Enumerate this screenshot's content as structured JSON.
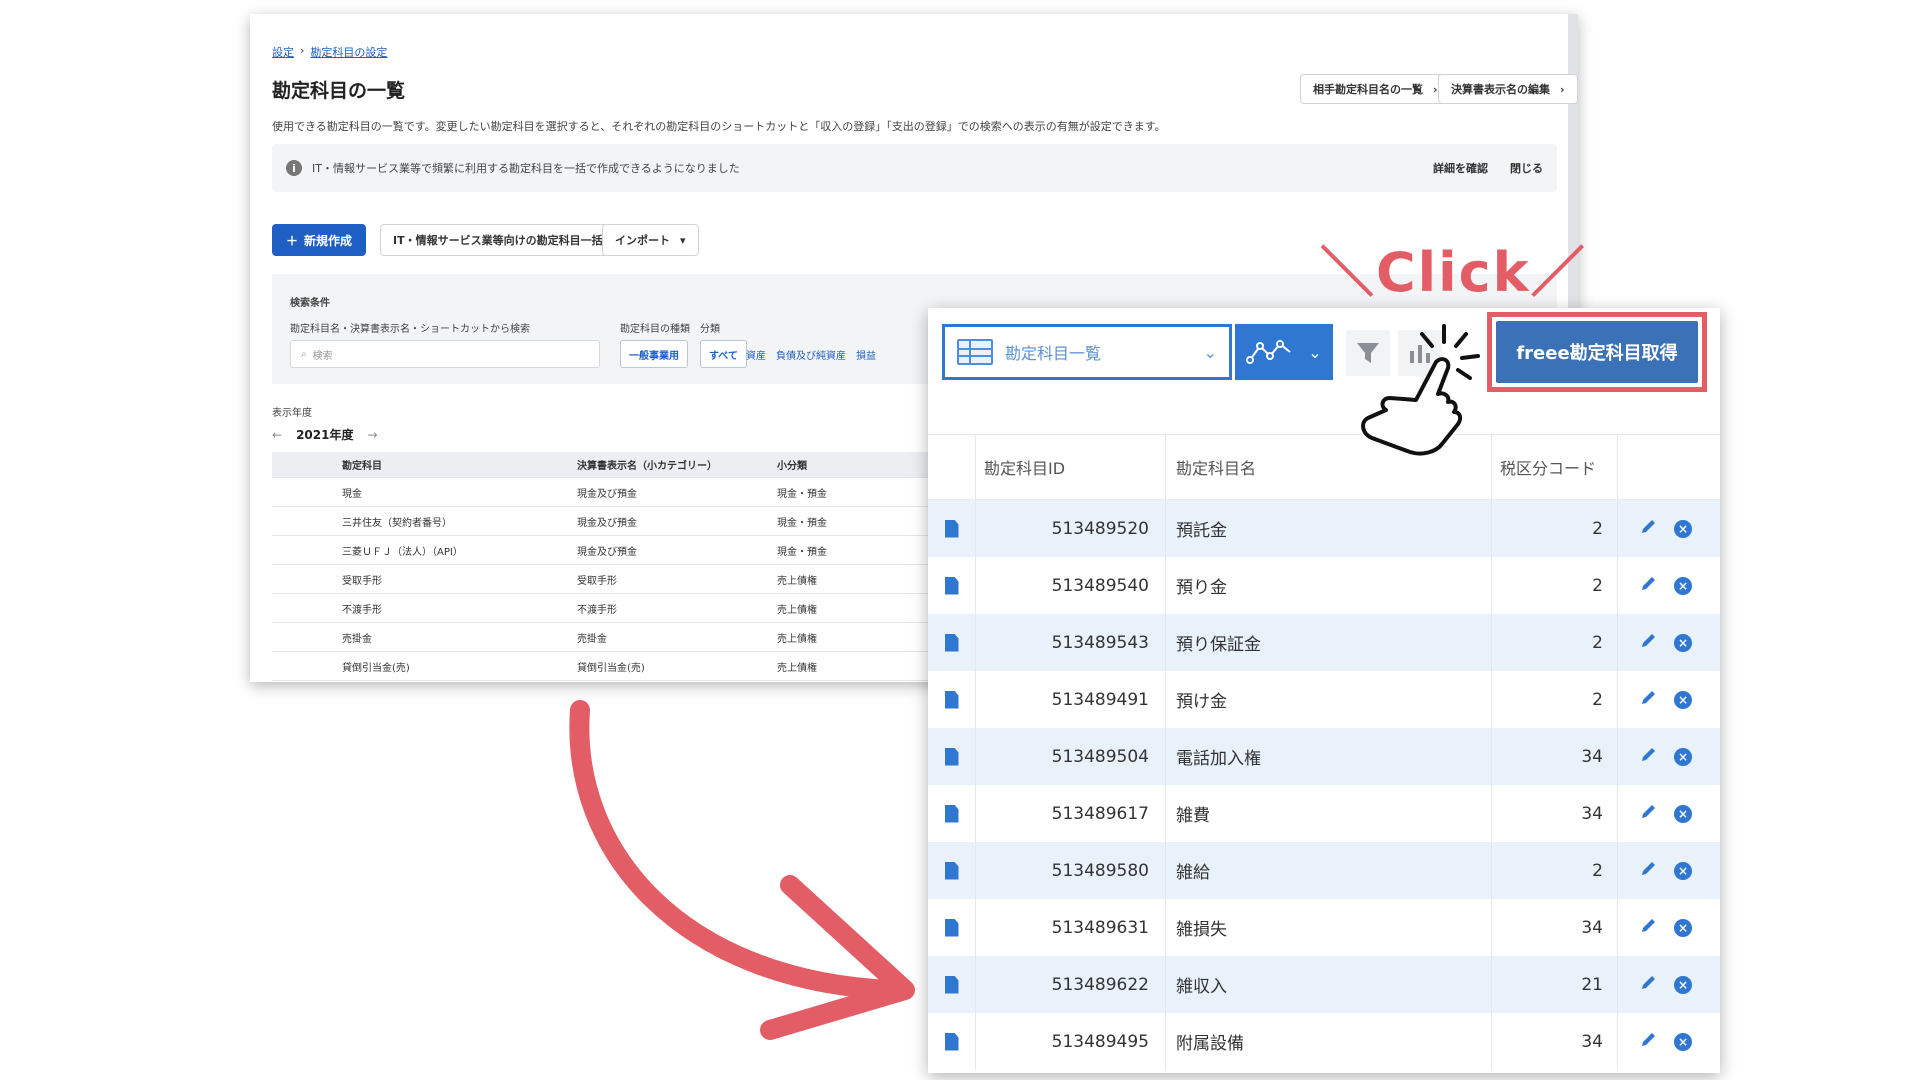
{
  "background_page": {
    "breadcrumb": [
      "設定",
      "勘定科目の設定"
    ],
    "title": "勘定科目の一覧",
    "top_buttons": [
      "相手勘定科目名の一覧",
      "決算書表示名の編集"
    ],
    "description": "使用できる勘定科目の一覧です。変更したい勘定科目を選択すると、それぞれの勘定科目のショートカットと「収入の登録」「支出の登録」での検索への表示の有無が設定できます。",
    "notice": {
      "text": "IT・情報サービス業等で頻繁に利用する勘定科目を一括で作成できるようになりました",
      "link_detail": "詳細を確認",
      "link_close": "閉じる"
    },
    "actions": {
      "new": "新規作成",
      "bulk": "IT・情報サービス業等向けの勘定科目一括設定",
      "import": "インポート"
    },
    "search": {
      "section_label": "検索条件",
      "field_label": "勘定科目名・決算書表示名・ショートカットから検索",
      "placeholder": "検索",
      "type_label": "勘定科目の種類",
      "type_value": "一般事業用",
      "class_label": "分類",
      "class_all": "すべて",
      "class_links": [
        "資産",
        "負債及び純資産",
        "損益"
      ]
    },
    "fiscal_year": {
      "label": "表示年度",
      "value": "2021年度"
    },
    "table": {
      "headers": [
        "勘定科目",
        "決算書表示名（小カテゴリー）",
        "小分類"
      ],
      "rows": [
        [
          "現金",
          "現金及び預金",
          "現金・預金"
        ],
        [
          "三井住友（契約者番号）",
          "現金及び預金",
          "現金・預金"
        ],
        [
          "三菱ＵＦＪ（法人）（API）",
          "現金及び預金",
          "現金・預金"
        ],
        [
          "受取手形",
          "受取手形",
          "売上債権"
        ],
        [
          "不渡手形",
          "不渡手形",
          "売上債権"
        ],
        [
          "売掛金",
          "売掛金",
          "売上債権"
        ],
        [
          "貸倒引当金(売)",
          "貸倒引当金(売)",
          "売上債権"
        ]
      ]
    }
  },
  "popup": {
    "view_select": "勘定科目一覧",
    "get_button": "freee勘定科目取得",
    "table": {
      "headers": [
        "勘定科目ID",
        "勘定科目名",
        "税区分コード"
      ],
      "rows": [
        [
          "513489520",
          "預託金",
          "2"
        ],
        [
          "513489540",
          "預り金",
          "2"
        ],
        [
          "513489543",
          "預り保証金",
          "2"
        ],
        [
          "513489491",
          "預け金",
          "2"
        ],
        [
          "513489504",
          "電話加入権",
          "34"
        ],
        [
          "513489617",
          "雑費",
          "34"
        ],
        [
          "513489580",
          "雑給",
          "2"
        ],
        [
          "513489631",
          "雑損失",
          "34"
        ],
        [
          "513489622",
          "雑収入",
          "21"
        ],
        [
          "513489495",
          "附属設備",
          "34"
        ]
      ]
    }
  },
  "annotation": {
    "click_label": "＼Click／",
    "accent_color": "#e35d66"
  }
}
